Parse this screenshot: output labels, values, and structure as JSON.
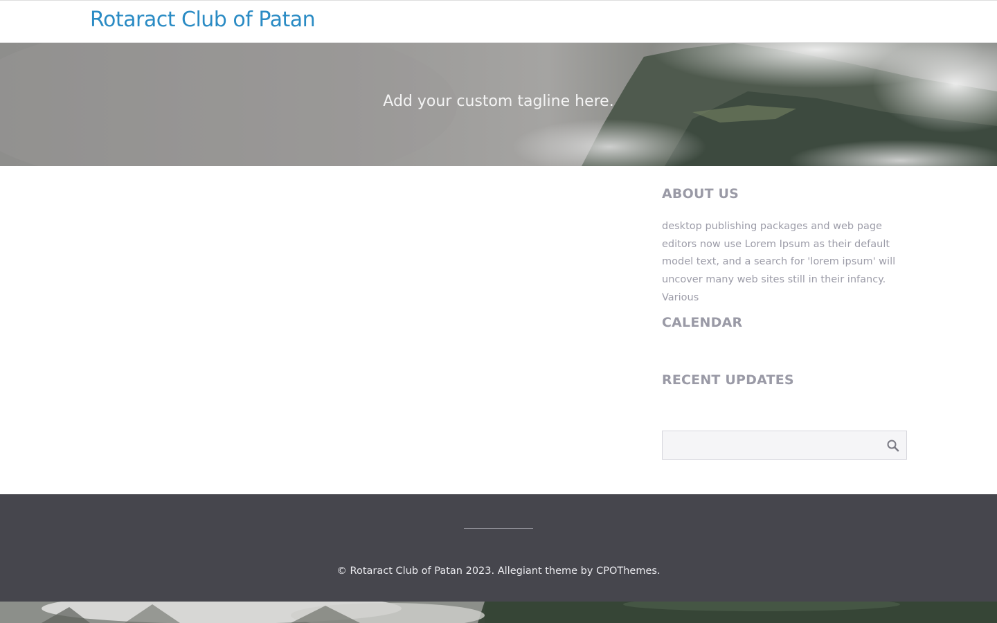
{
  "header": {
    "site_title": "Rotaract Club of Patan"
  },
  "hero": {
    "tagline": "Add your custom tagline here."
  },
  "sidebar": {
    "about": {
      "title": "ABOUT US",
      "text": "desktop publishing packages and web page editors now use Lorem Ipsum as their default model text, and a search for 'lorem ipsum' will uncover many web sites still in their infancy. Various"
    },
    "calendar": {
      "title": "CALENDAR"
    },
    "recent": {
      "title": "RECENT UPDATES"
    },
    "search": {
      "value": "",
      "icon": "search-icon"
    }
  },
  "footer": {
    "copyright": "© Rotaract Club of Patan 2023.",
    "theme_text": "Allegiant theme by",
    "theme_link": "CPOThemes",
    "period": "."
  },
  "colors": {
    "site_title": "#2a8bc4",
    "widget_title": "#9a9aa6",
    "footer_bg": "#46464d",
    "footer_text": "#ececf0"
  }
}
